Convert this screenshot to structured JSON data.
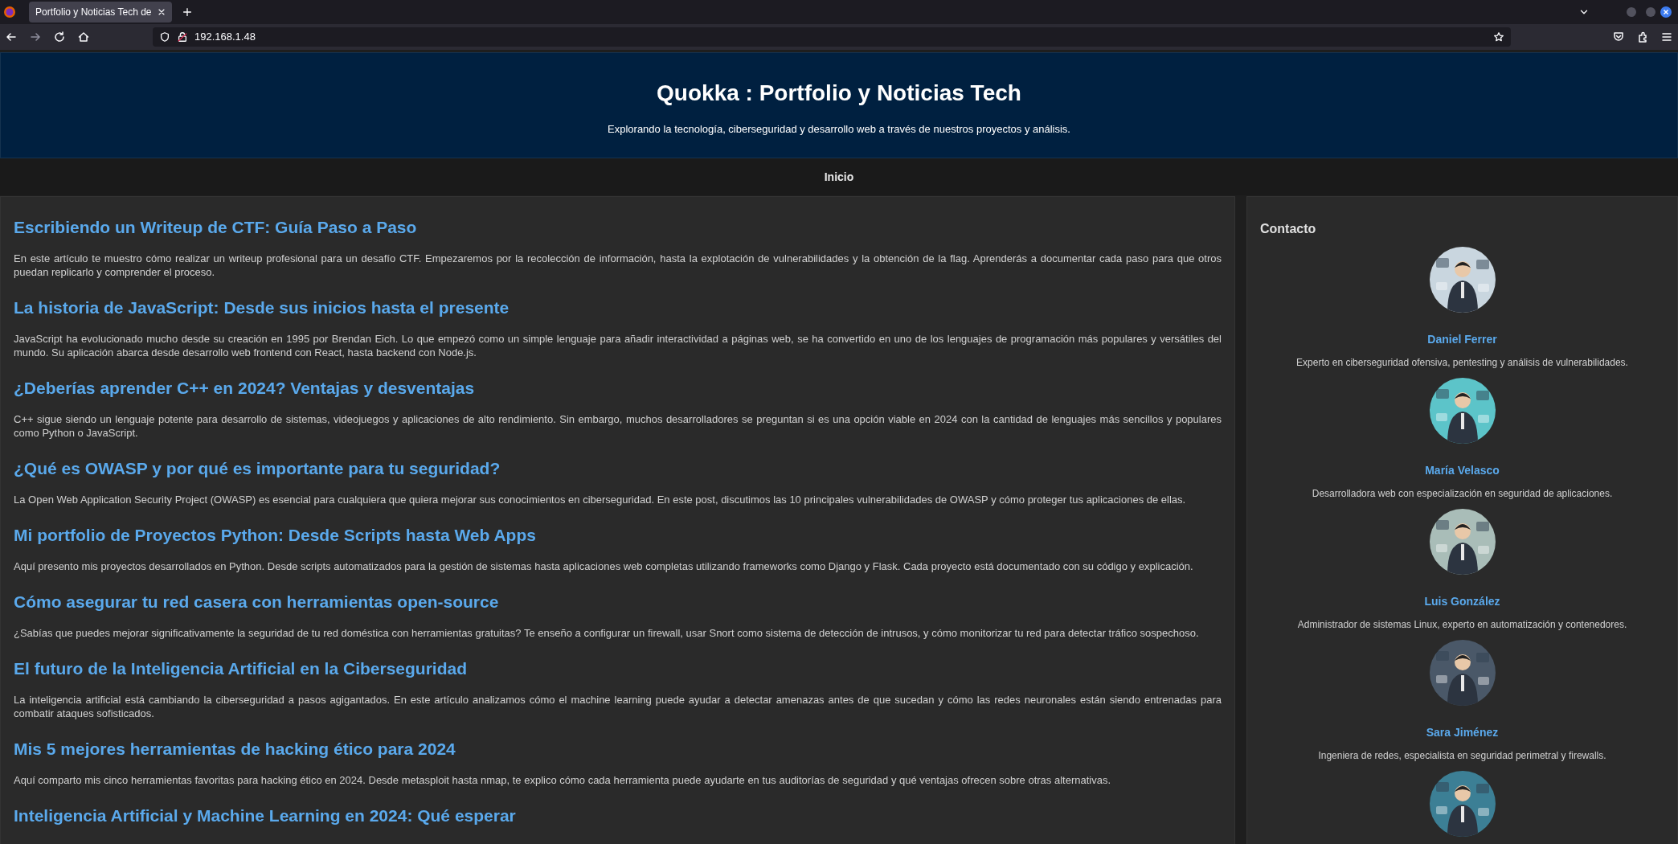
{
  "browser": {
    "tabs": [
      {
        "title": "Portfolio y Noticias Tech de",
        "selected": true
      }
    ],
    "url": "192.168.1.48"
  },
  "header": {
    "title": "Quokka : Portfolio y Noticias Tech",
    "subtitle": "Explorando la tecnología, ciberseguridad y desarrollo web a través de nuestros proyectos y análisis."
  },
  "nav": [
    {
      "label": "Inicio"
    }
  ],
  "articles": [
    {
      "title": "Escribiendo un Writeup de CTF: Guía Paso a Paso",
      "text": "En este artículo te muestro cómo realizar un writeup profesional para un desafío CTF. Empezaremos por la recolección de información, hasta la explotación de vulnerabilidades y la obtención de la flag. Aprenderás a documentar cada paso para que otros puedan replicarlo y comprender el proceso."
    },
    {
      "title": "La historia de JavaScript: Desde sus inicios hasta el presente",
      "text": "JavaScript ha evolucionado mucho desde su creación en 1995 por Brendan Eich. Lo que empezó como un simple lenguaje para añadir interactividad a páginas web, se ha convertido en uno de los lenguajes de programación más populares y versátiles del mundo. Su aplicación abarca desde desarrollo web frontend con React, hasta backend con Node.js."
    },
    {
      "title": "¿Deberías aprender C++ en 2024? Ventajas y desventajas",
      "text": "C++ sigue siendo un lenguaje potente para desarrollo de sistemas, videojuegos y aplicaciones de alto rendimiento. Sin embargo, muchos desarrolladores se preguntan si es una opción viable en 2024 con la cantidad de lenguajes más sencillos y populares como Python o JavaScript."
    },
    {
      "title": "¿Qué es OWASP y por qué es importante para tu seguridad?",
      "text": "La Open Web Application Security Project (OWASP) es esencial para cualquiera que quiera mejorar sus conocimientos en ciberseguridad. En este post, discutimos las 10 principales vulnerabilidades de OWASP y cómo proteger tus aplicaciones de ellas."
    },
    {
      "title": "Mi portfolio de Proyectos Python: Desde Scripts hasta Web Apps",
      "text": "Aquí presento mis proyectos desarrollados en Python. Desde scripts automatizados para la gestión de sistemas hasta aplicaciones web completas utilizando frameworks como Django y Flask. Cada proyecto está documentado con su código y explicación."
    },
    {
      "title": "Cómo asegurar tu red casera con herramientas open-source",
      "text": "¿Sabías que puedes mejorar significativamente la seguridad de tu red doméstica con herramientas gratuitas? Te enseño a configurar un firewall, usar Snort como sistema de detección de intrusos, y cómo monitorizar tu red para detectar tráfico sospechoso."
    },
    {
      "title": "El futuro de la Inteligencia Artificial en la Ciberseguridad",
      "text": "La inteligencia artificial está cambiando la ciberseguridad a pasos agigantados. En este artículo analizamos cómo el machine learning puede ayudar a detectar amenazas antes de que sucedan y cómo las redes neuronales están siendo entrenadas para combatir ataques sofisticados."
    },
    {
      "title": "Mis 5 mejores herramientas de hacking ético para 2024",
      "text": "Aquí comparto mis cinco herramientas favoritas para hacking ético en 2024. Desde metasploit hasta nmap, te explico cómo cada herramienta puede ayudarte en tus auditorías de seguridad y qué ventajas ofrecen sobre otras alternativas."
    },
    {
      "title": "Inteligencia Artificial y Machine Learning en 2024: Qué esperar"
    }
  ],
  "sidebar": {
    "title": "Contacto",
    "contacts": [
      {
        "name": "Daniel Ferrer",
        "role": "Experto en ciberseguridad ofensiva, pentesting y análisis de vulnerabilidades.",
        "color": "#c9d6df"
      },
      {
        "name": "María Velasco",
        "role": "Desarrolladora web con especialización en seguridad de aplicaciones.",
        "color": "#5cc4c9"
      },
      {
        "name": "Luis González",
        "role": "Administrador de sistemas Linux, experto en automatización y contenedores.",
        "color": "#a9bdb8"
      },
      {
        "name": "Sara Jiménez",
        "role": "Ingeniera de redes, especialista en seguridad perimetral y firewalls.",
        "color": "#4a5868"
      },
      {
        "color": "#3c7f95"
      }
    ]
  }
}
